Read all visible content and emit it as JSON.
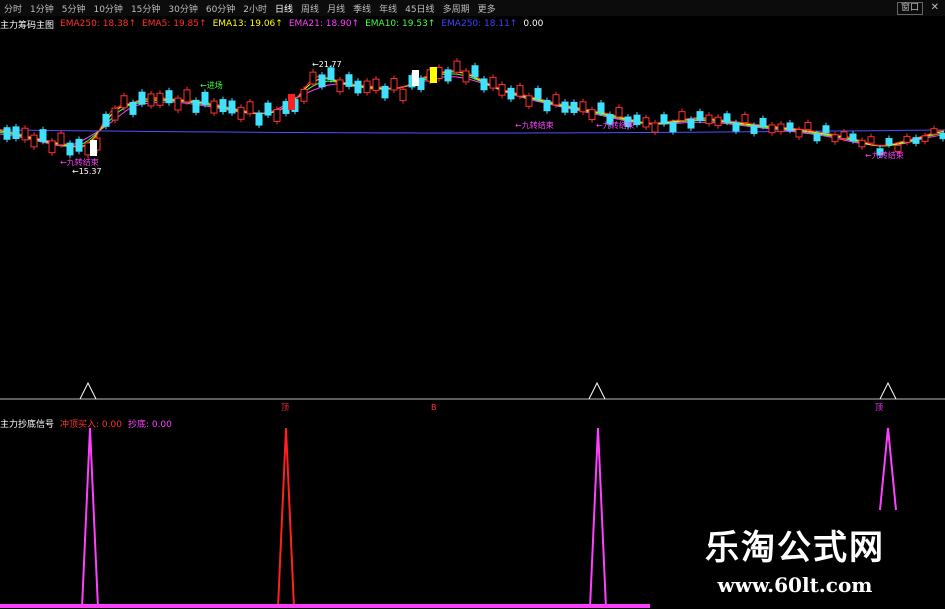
{
  "toolbar": {
    "timeframes": [
      "分时",
      "1分钟",
      "5分钟",
      "10分钟",
      "15分钟",
      "30分钟",
      "60分钟",
      "2小时",
      "日线",
      "周线",
      "月线",
      "季线",
      "年线",
      "45日线",
      "多周期",
      "更多"
    ],
    "active_index": 8,
    "window_button": "窗口",
    "close": "✕"
  },
  "indicator_info": {
    "label": "主力筹码主图",
    "items": [
      {
        "text": "EMA250: 18.38↑",
        "color": "#ff3030"
      },
      {
        "text": "EMA5: 19.85↑",
        "color": "#ff3030"
      },
      {
        "text": "EMA13: 19.06↑",
        "color": "#ffff00"
      },
      {
        "text": "EMA21: 18.90↑",
        "color": "#ff40ff"
      },
      {
        "text": "EMA10: 19.53↑",
        "color": "#40ff40"
      },
      {
        "text": "EMA250: 18.11↑",
        "color": "#4040ff"
      },
      {
        "text": "0.00",
        "color": "#ffffff"
      }
    ]
  },
  "annotations": {
    "buy_signal": "←进场",
    "nine_end": "←九转结束",
    "low_label": "←15.37",
    "nine_end_2": "←九转结束",
    "nine_end_3": "←九转结束",
    "bottom_left": "←九转结束",
    "sell_label": "←21.77"
  },
  "signal_markers": {
    "a": "顶",
    "b": "B",
    "c": "顶"
  },
  "sub_info": {
    "title": "主力抄底信号",
    "items": [
      {
        "text": "冲顶买入: 0.00",
        "color": "#ff3030"
      },
      {
        "text": "抄底: 0.00",
        "color": "#ff40ff"
      }
    ]
  },
  "watermark": {
    "title": "乐淘公式网",
    "url": "www.60lt.com"
  }
}
